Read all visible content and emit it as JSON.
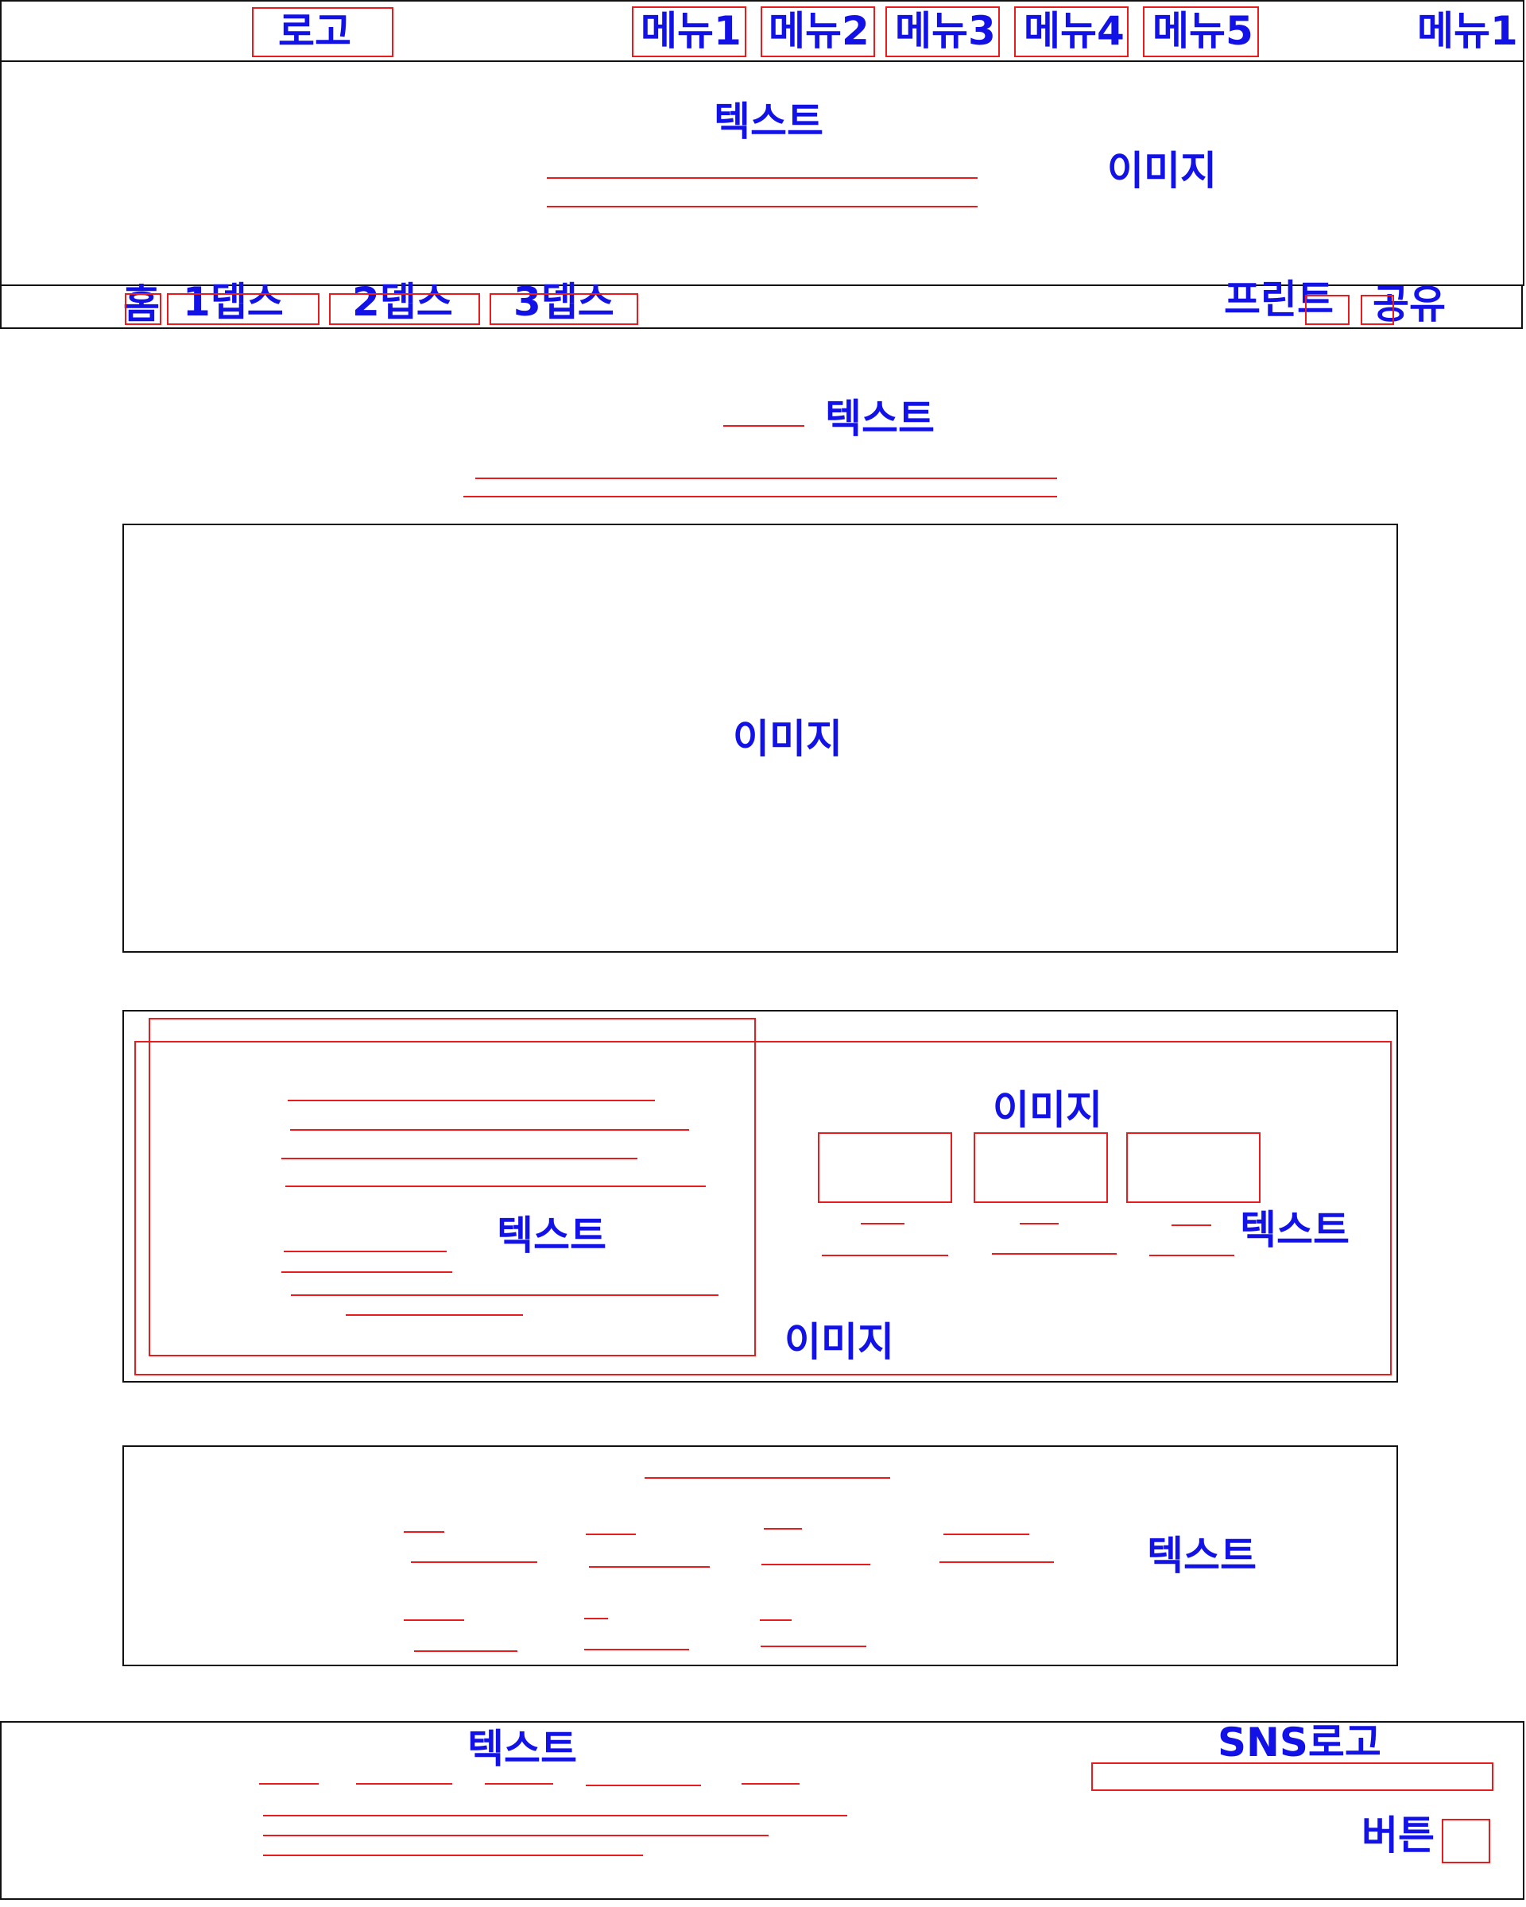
{
  "header": {
    "logo": "로고",
    "menus": [
      "메뉴1",
      "메뉴2",
      "메뉴3",
      "메뉴4",
      "메뉴5"
    ],
    "menu_right": "메뉴1"
  },
  "hero": {
    "text": "텍스트",
    "image": "이미지"
  },
  "breadcrumb": {
    "home": "홈",
    "depth1": "1뎁스",
    "depth2": "2뎁스",
    "depth3": "3뎁스",
    "print": "프린트",
    "share": "공유"
  },
  "title": {
    "text": "텍스트"
  },
  "main_image": {
    "label": "이미지"
  },
  "content_section": {
    "image_top": "이미지",
    "left_text": "텍스트",
    "right_text": "텍스트",
    "image_bottom": "이미지"
  },
  "links_section": {
    "text": "텍스트"
  },
  "footer": {
    "text": "텍스트",
    "sns_logo": "SNS로고",
    "button": "버튼"
  },
  "colors": {
    "label": "#1212e6",
    "annotation": "#e81c1c",
    "frame": "#111111"
  }
}
